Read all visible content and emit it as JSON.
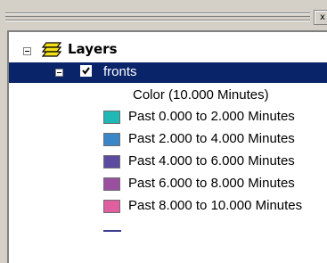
{
  "window": {
    "close_label": "x"
  },
  "toc": {
    "root_label": "Layers",
    "layer": {
      "name": "fronts",
      "checked": true,
      "legend_heading": "Color (10.000 Minutes)",
      "classes": [
        {
          "label": "Past 0.000 to 2.000 Minutes",
          "color": "#1fb8b5"
        },
        {
          "label": "Past 2.000 to 4.000 Minutes",
          "color": "#3a86c8"
        },
        {
          "label": "Past 4.000 to 6.000 Minutes",
          "color": "#5c4ba0"
        },
        {
          "label": "Past 6.000 to 8.000 Minutes",
          "color": "#9b4fa0"
        },
        {
          "label": "Past 8.000 to 10.000 Minutes",
          "color": "#e05fa0"
        }
      ],
      "line_symbol_color": "#3b3b8f"
    }
  }
}
